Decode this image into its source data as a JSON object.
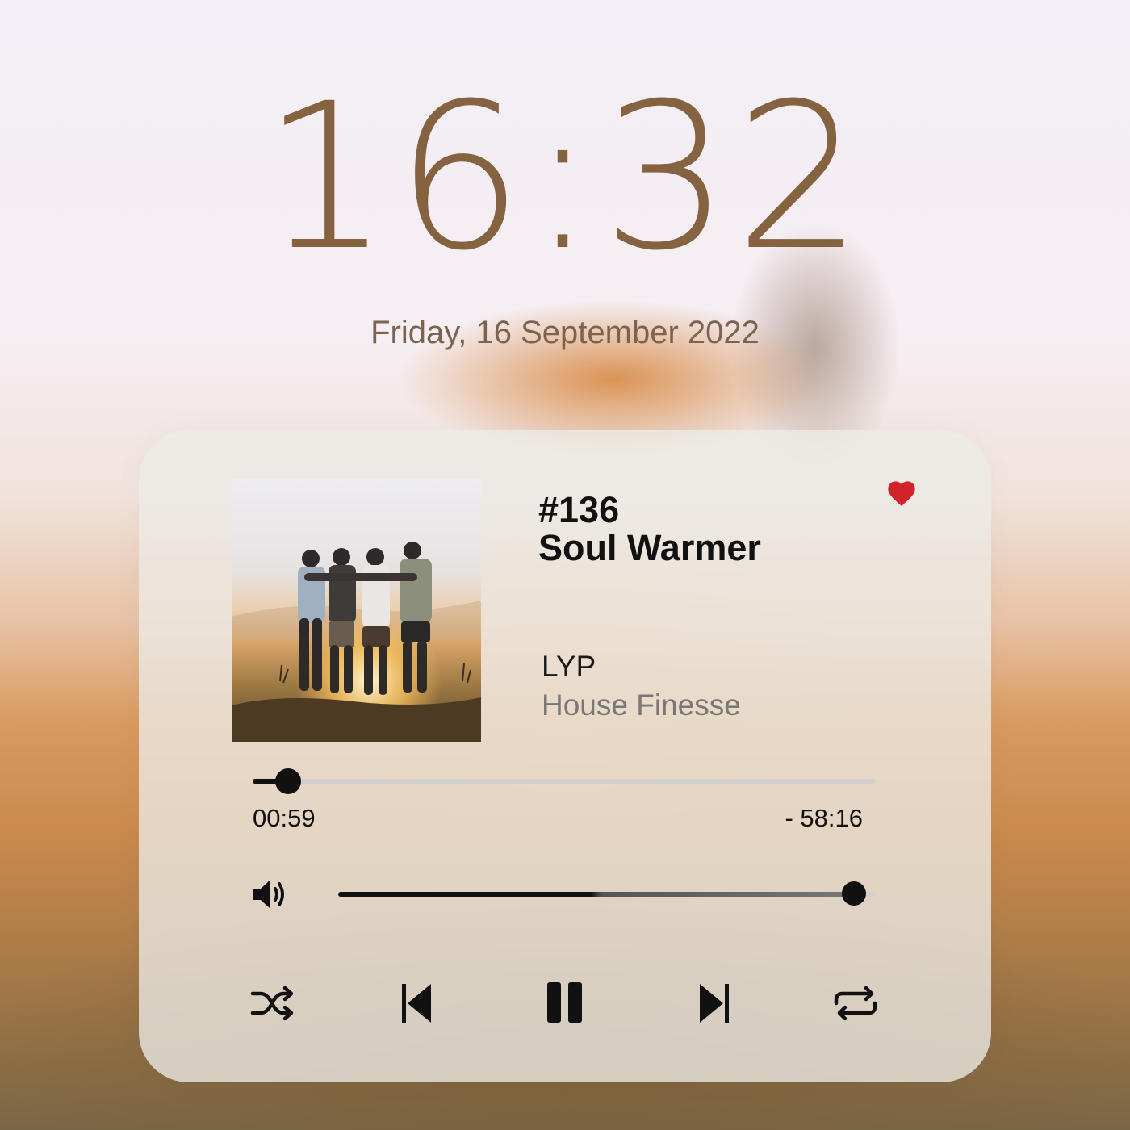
{
  "lockscreen": {
    "time": "16:32",
    "date": "Friday, 16 September 2022"
  },
  "player": {
    "episode": "#136",
    "title": "Soul Warmer",
    "artist": "LYP",
    "album": "House Finesse",
    "liked": true,
    "elapsed": "00:59",
    "remaining": "- 58:16",
    "progress_fraction": 0.057,
    "volume_fraction": 0.96,
    "controls": [
      "shuffle-icon",
      "previous-icon",
      "pause-icon",
      "next-icon",
      "repeat-icon"
    ]
  },
  "colors": {
    "clock": "#866340",
    "heart": "#d0232b",
    "accent": "#111111"
  }
}
